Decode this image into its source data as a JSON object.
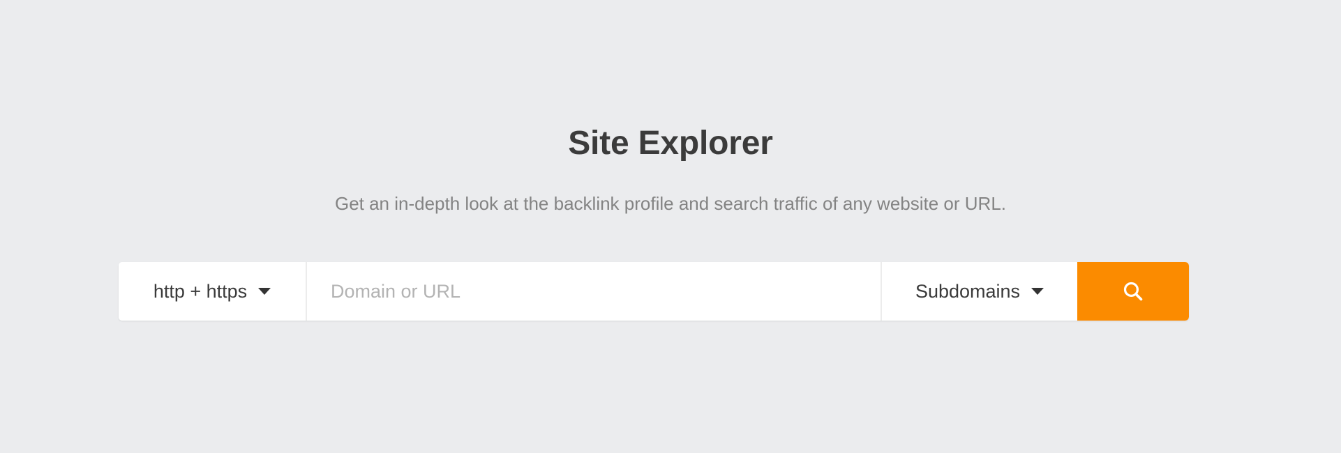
{
  "page": {
    "background_color": "#ebecee"
  },
  "hero": {
    "title": "Site Explorer",
    "subtitle": "Get an in-depth look at the backlink profile and search traffic of any website or URL."
  },
  "search": {
    "protocol_dropdown": {
      "selected": "http + https",
      "caret_icon": "chevron-down-icon"
    },
    "domain_input": {
      "value": "",
      "placeholder": "Domain or URL"
    },
    "scope_dropdown": {
      "selected": "Subdomains",
      "caret_icon": "chevron-down-icon"
    },
    "submit_button": {
      "icon": "search-icon",
      "label": "",
      "accent_color": "#fb8b00"
    }
  },
  "colors": {
    "accent": "#fb8b00",
    "title_text": "#3b3b3b",
    "subtitle_text": "#838383",
    "field_text": "#3a3a3a",
    "placeholder_text": "#b3b3b3",
    "divider": "#ececec",
    "surface": "#ffffff"
  }
}
